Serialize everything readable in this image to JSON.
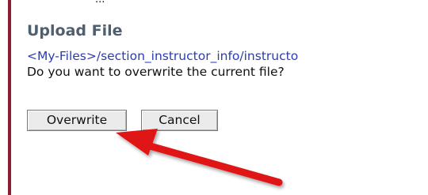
{
  "header_clip": "...",
  "dialog": {
    "title": "Upload File",
    "path": "<My-Files>/section_instructor_info/instructo",
    "question": "Do you want to overwrite the current file?"
  },
  "buttons": {
    "overwrite_label": "Overwrite",
    "cancel_label": "Cancel"
  },
  "colors": {
    "accent_bar": "#8e1c2e",
    "title": "#4f5f6e",
    "path_link": "#2a3db0",
    "annotation_arrow": "#e01818"
  }
}
